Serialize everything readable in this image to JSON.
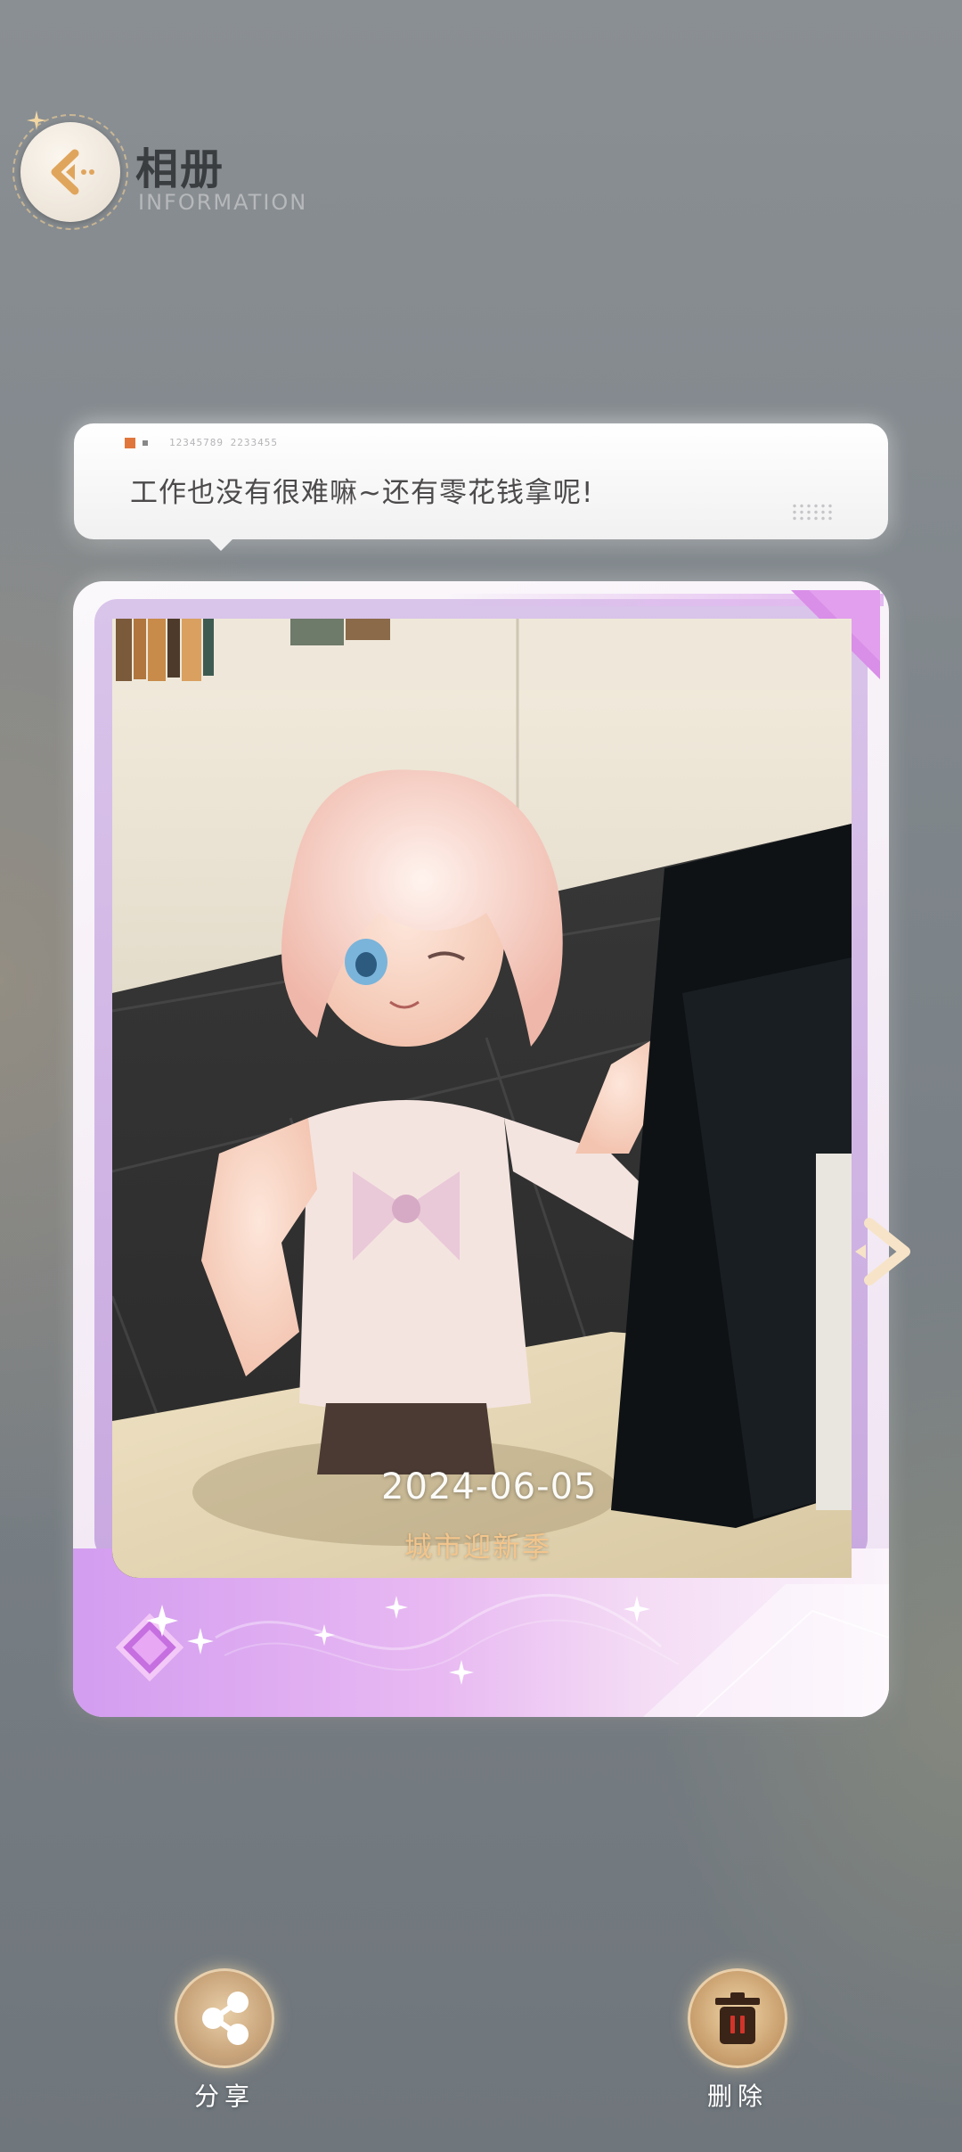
{
  "header": {
    "title": "相册",
    "subtitle": "INFORMATION",
    "back_icon": "back-arrow-icon"
  },
  "bubble": {
    "tag_code": "12345789 2233455",
    "text": "工作也没有很难嘛~还有零花钱拿呢!"
  },
  "photo": {
    "date": "2024-06-05",
    "caption": "城市迎新季"
  },
  "actions": {
    "share_label": "分享",
    "delete_label": "删除",
    "share_icon": "share-icon",
    "delete_icon": "trash-icon"
  },
  "colors": {
    "accent_gold": "#e8b36a",
    "card_purple": "#d39df0",
    "caption_gold": "#f2c58c"
  }
}
